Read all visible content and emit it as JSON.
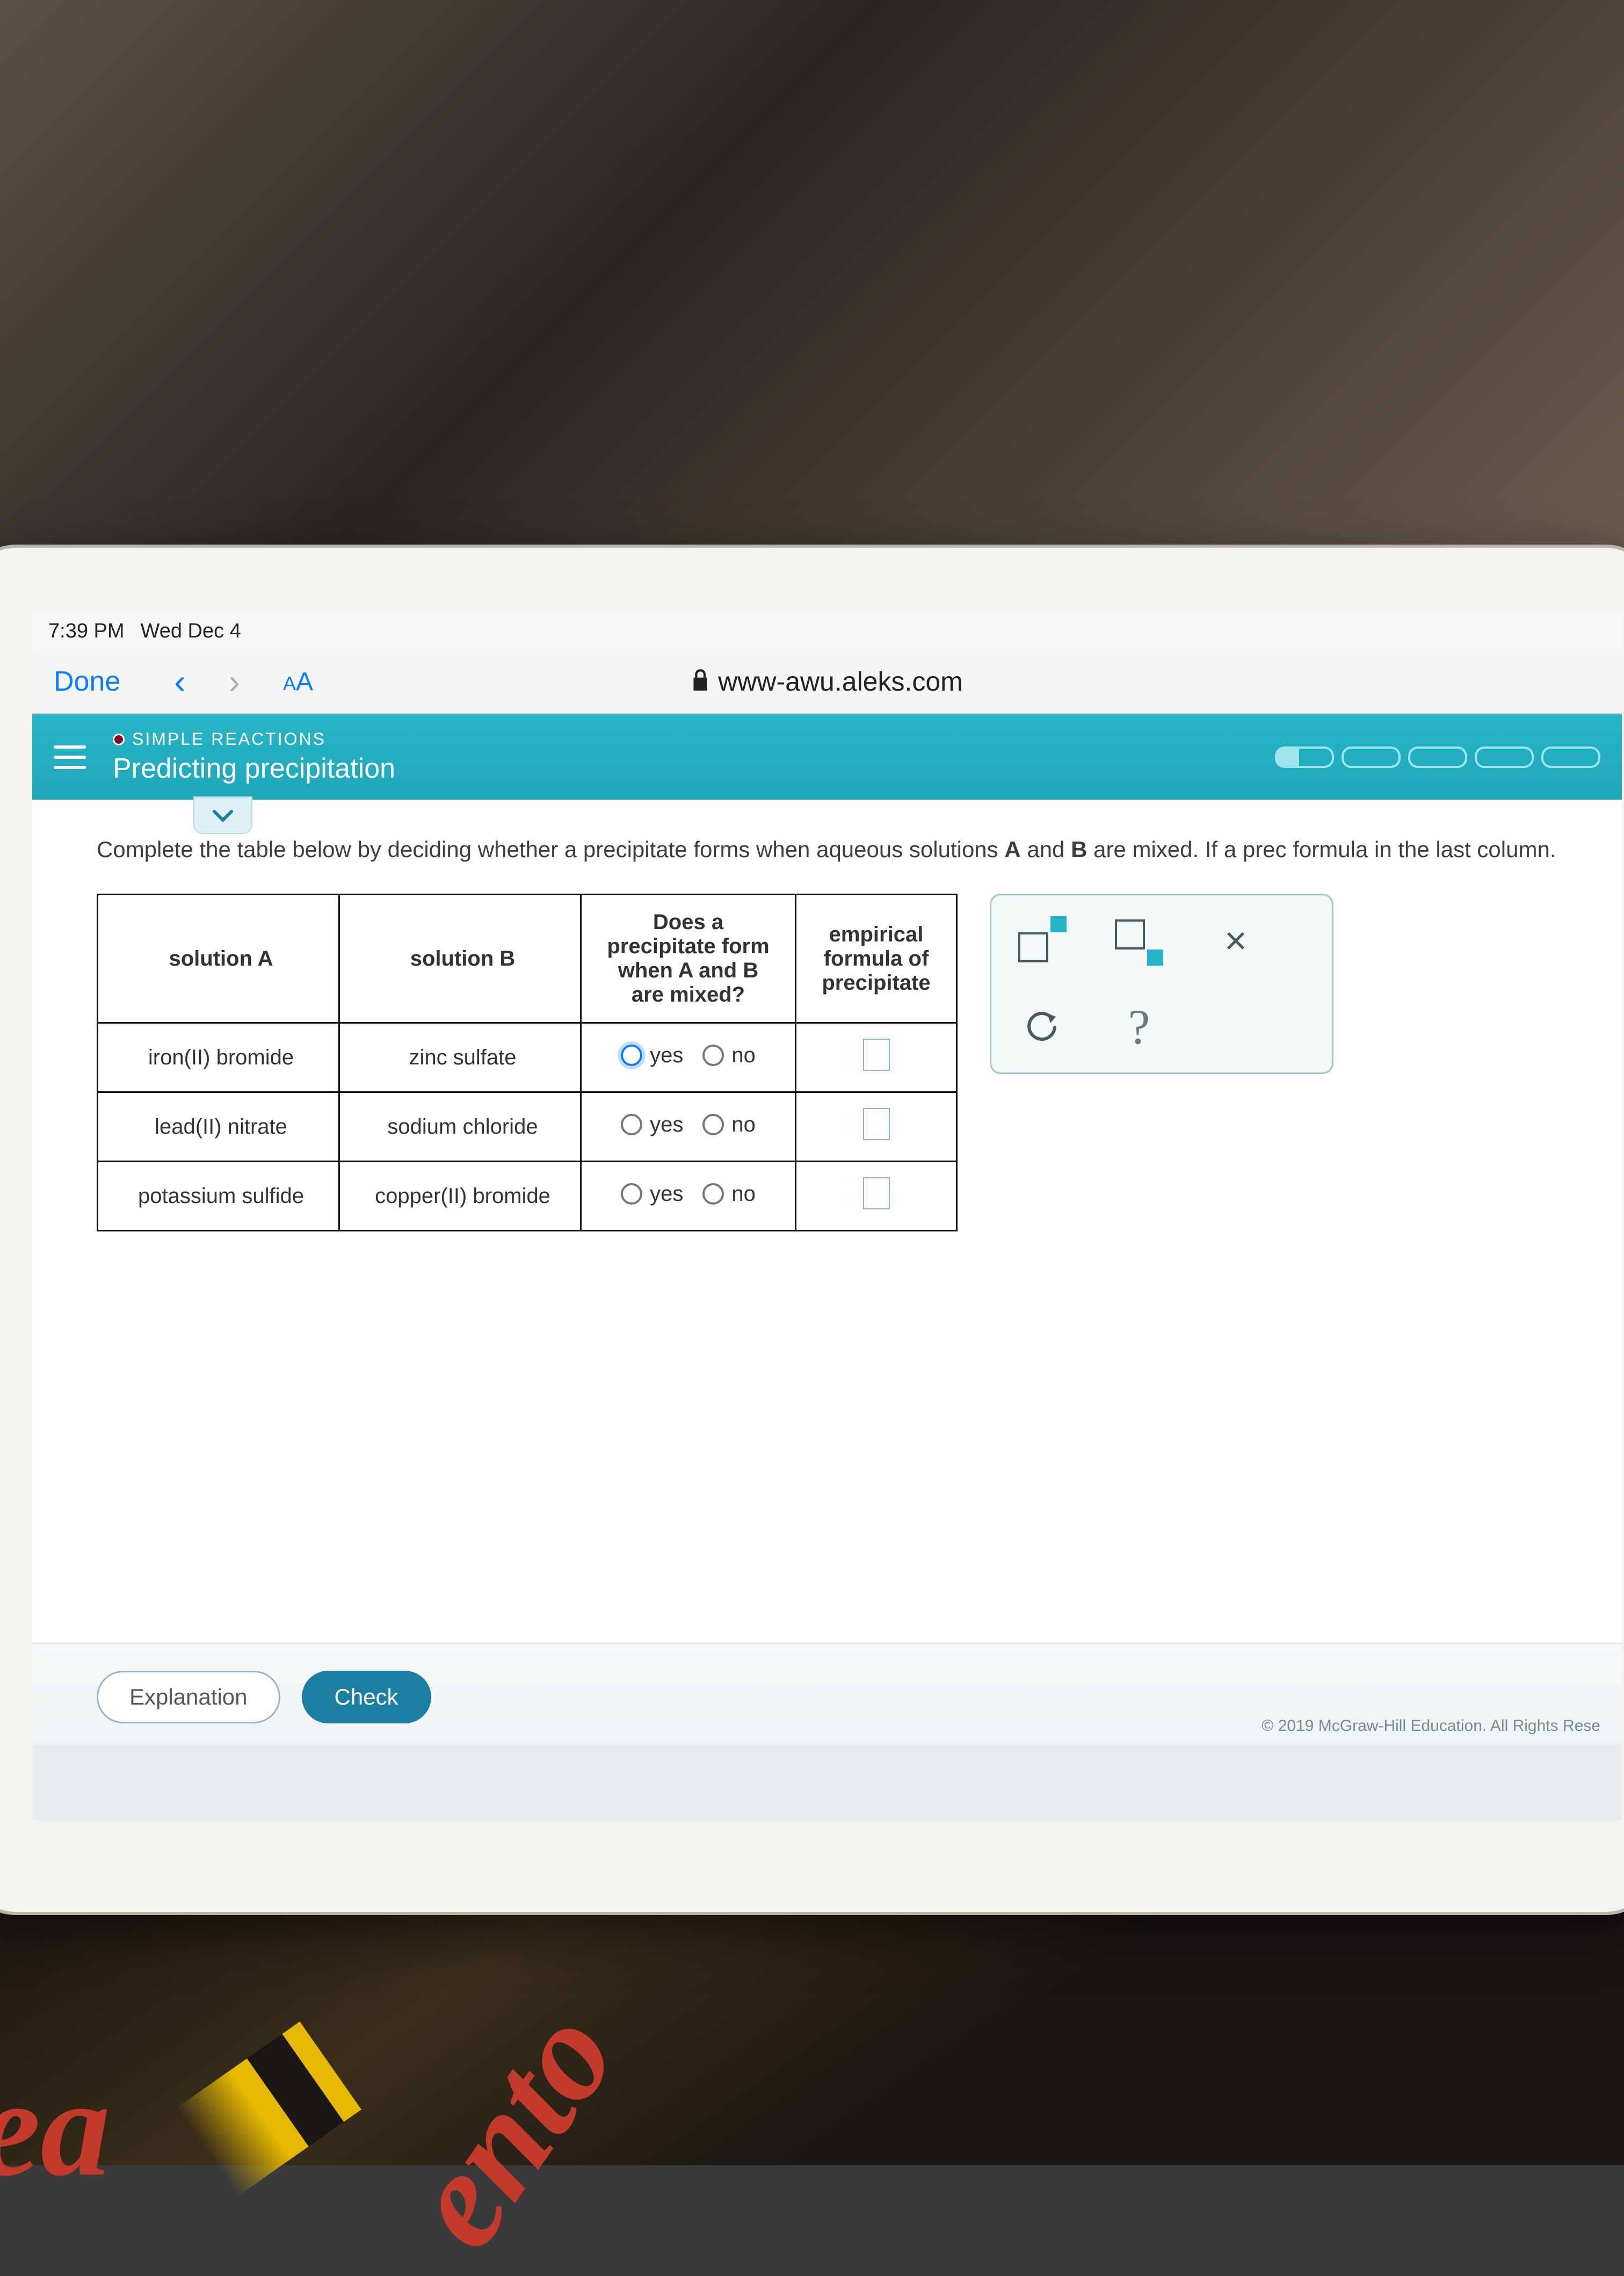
{
  "status": {
    "time": "7:39 PM",
    "date": "Wed Dec 4"
  },
  "safari": {
    "done": "Done",
    "aa": "AA",
    "url": "www-awu.aleks.com"
  },
  "header": {
    "kicker": "SIMPLE REACTIONS",
    "title": "Predicting precipitation"
  },
  "instruction": "Complete the table below by deciding whether a precipitate forms when aqueous solutions <b>A</b> and <b>B</b> are mixed. If a prec formula in the last column.",
  "table": {
    "headers": {
      "a": "solution A",
      "b": "solution B",
      "q": "Does a precipitate form when A and B are mixed?",
      "f": "empirical formula of precipitate"
    },
    "yes": "yes",
    "no": "no",
    "rows": [
      {
        "a": "iron(II) bromide",
        "b": "zinc sulfate",
        "sel": "yes"
      },
      {
        "a": "lead(II) nitrate",
        "b": "sodium chloride",
        "sel": ""
      },
      {
        "a": "potassium sulfide",
        "b": "copper(II) bromide",
        "sel": ""
      }
    ]
  },
  "toolpanel": {
    "close": "×",
    "help": "?"
  },
  "buttons": {
    "explanation": "Explanation",
    "check": "Check"
  },
  "copyright": "© 2019 McGraw-Hill Education. All Rights Rese"
}
